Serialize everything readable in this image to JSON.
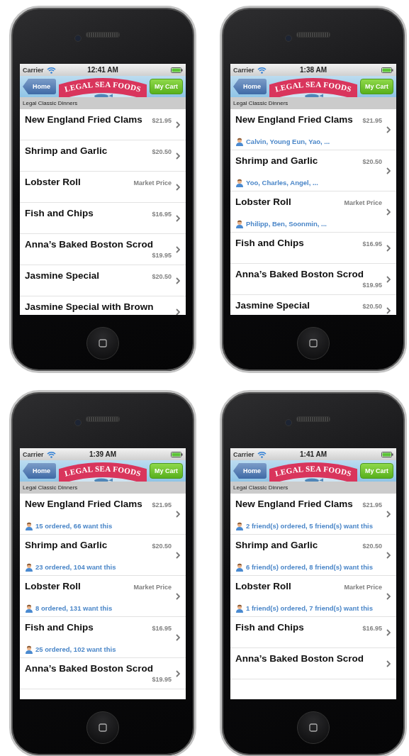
{
  "phones": [
    {
      "status_bar": {
        "carrier": "Carrier",
        "time": "12:41 AM"
      },
      "nav_bar": {
        "back_button": "Home",
        "logo_text": "LEGAL SEA FOODS",
        "cart_button": "My Cart"
      },
      "section_header": "Legal Classic Dinners",
      "items": [
        {
          "name": "New England Fried Clams",
          "price": "$21.95"
        },
        {
          "name": "Shrimp and Garlic",
          "price": "$20.50"
        },
        {
          "name": "Lobster Roll",
          "price": "Market Price"
        },
        {
          "name": "Fish and Chips",
          "price": "$16.95"
        },
        {
          "name": "Anna’s Baked Boston Scrod",
          "price": "$19.95"
        },
        {
          "name": "Jasmine Special",
          "price": "$20.50"
        },
        {
          "name": "Jasmine Special with Brown"
        }
      ]
    },
    {
      "status_bar": {
        "carrier": "Carrier",
        "time": "1:38 AM"
      },
      "nav_bar": {
        "back_button": "Home",
        "logo_text": "LEGAL SEA FOODS",
        "cart_button": "My Cart"
      },
      "section_header": "Legal Classic Dinners",
      "items": [
        {
          "name": "New England Fried Clams",
          "price": "$21.95",
          "social": "Calvin, Young Eun, Yao, ..."
        },
        {
          "name": "Shrimp and Garlic",
          "price": "$20.50",
          "social": "Yoo, Charles, Angel, ..."
        },
        {
          "name": "Lobster Roll",
          "price": "Market Price",
          "social": "Philipp, Ben, Soonmin, ..."
        },
        {
          "name": "Fish and Chips",
          "price": "$16.95"
        },
        {
          "name": "Anna’s Baked Boston Scrod",
          "price": "$19.95"
        },
        {
          "name": "Jasmine Special",
          "price": "$20.50"
        }
      ]
    },
    {
      "status_bar": {
        "carrier": "Carrier",
        "time": "1:39 AM"
      },
      "nav_bar": {
        "back_button": "Home",
        "logo_text": "LEGAL SEA FOODS",
        "cart_button": "My Cart"
      },
      "section_header": "Legal Classic Dinners",
      "items": [
        {
          "name": "New England Fried Clams",
          "price": "$21.95",
          "social": "15 ordered, 66 want this"
        },
        {
          "name": "Shrimp and Garlic",
          "price": "$20.50",
          "social": "23 ordered, 104 want this"
        },
        {
          "name": "Lobster Roll",
          "price": "Market Price",
          "social": "8 ordered, 131 want this"
        },
        {
          "name": "Fish and Chips",
          "price": "$16.95",
          "social": "25 ordered, 102 want this"
        },
        {
          "name": "Anna’s Baked Boston Scrod",
          "price": "$19.95"
        }
      ]
    },
    {
      "status_bar": {
        "carrier": "Carrier",
        "time": "1:41 AM"
      },
      "nav_bar": {
        "back_button": "Home",
        "logo_text": "LEGAL SEA FOODS",
        "cart_button": "My Cart"
      },
      "section_header": "Legal Classic Dinners",
      "items": [
        {
          "name": "New England Fried Clams",
          "price": "$21.95",
          "social": "2 friend(s) ordered, 5 friend(s) want this"
        },
        {
          "name": "Shrimp and Garlic",
          "price": "$20.50",
          "social": "6 friend(s) ordered, 8 friend(s) want this"
        },
        {
          "name": "Lobster Roll",
          "price": "Market Price",
          "social": "1 friend(s) ordered, 7 friend(s) want this"
        },
        {
          "name": "Fish and Chips",
          "price": "$16.95"
        },
        {
          "name": "Anna’s Baked Boston Scrod"
        }
      ]
    }
  ]
}
